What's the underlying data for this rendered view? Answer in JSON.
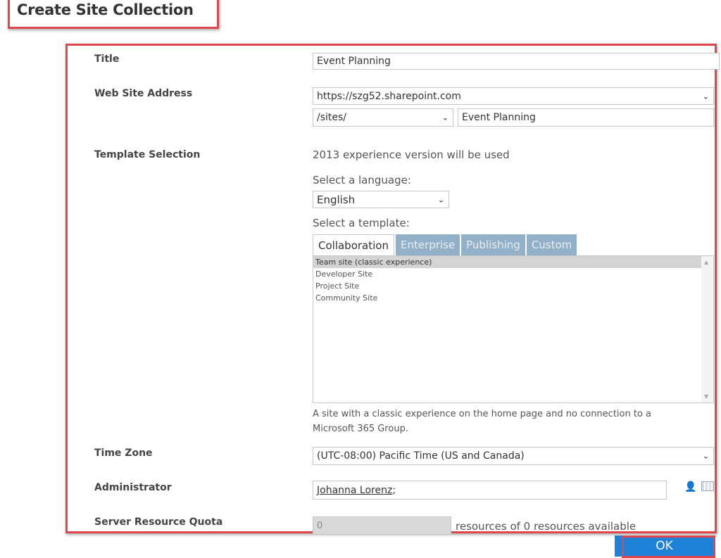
{
  "page": {
    "title": "Create Site Collection"
  },
  "form": {
    "title": {
      "label": "Title",
      "value": "Event Planning"
    },
    "web_site_address": {
      "label": "Web Site Address",
      "domain_value": "https://szg52.sharepoint.com",
      "path_value": "/sites/",
      "site_name_value": "Event Planning"
    },
    "template_selection": {
      "label": "Template Selection",
      "version_note": "2013 experience version will be used",
      "language_label": "Select a language:",
      "language_value": "English",
      "template_label": "Select a template:",
      "tabs": [
        {
          "label": "Collaboration",
          "active": true
        },
        {
          "label": "Enterprise",
          "active": false
        },
        {
          "label": "Publishing",
          "active": false
        },
        {
          "label": "Custom",
          "active": false
        }
      ],
      "templates": [
        {
          "label": "Team site (classic experience)",
          "selected": true
        },
        {
          "label": "Developer Site",
          "selected": false
        },
        {
          "label": "Project Site",
          "selected": false
        },
        {
          "label": "Community Site",
          "selected": false
        }
      ],
      "description": "A site with a classic experience on the home page and no connection to a Microsoft 365 Group."
    },
    "time_zone": {
      "label": "Time Zone",
      "value": "(UTC-08:00) Pacific Time (US and Canada)"
    },
    "administrator": {
      "label": "Administrator",
      "value": "Johanna Lorenz",
      "separator": ";"
    },
    "server_resource_quota": {
      "label": "Server Resource Quota",
      "value": "0",
      "suffix": "resources of 0 resources available"
    }
  },
  "actions": {
    "ok_label": "OK"
  },
  "icons": {
    "chevron": "⌄",
    "scroll_up": "▲",
    "scroll_down": "▼",
    "people": "👤"
  },
  "colors": {
    "highlight": "#e0474c",
    "ok_button": "#1e82d8",
    "tab_inactive": "#92b1c8"
  }
}
